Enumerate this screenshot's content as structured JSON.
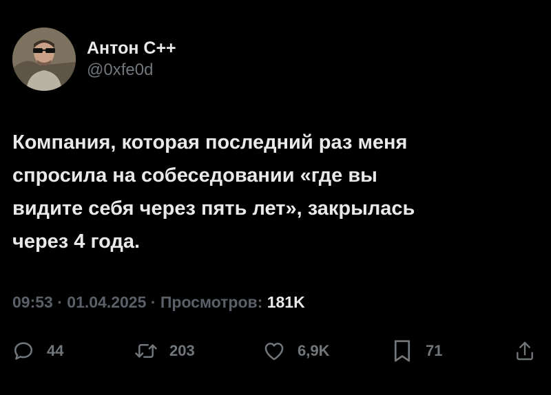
{
  "author": {
    "display_name": "Антон C++",
    "handle": "@0xfe0d",
    "avatar_icon": "user-avatar"
  },
  "tweet": {
    "text": "Компания, которая последний раз меня\nспросила на собеседовании «где вы\nвидите себя через пять лет», закрылась\nчерез 4 года."
  },
  "meta": {
    "time": "09:53",
    "separator": " · ",
    "date": "01.04.2025",
    "views_label": "Просмотров:",
    "views_count": "181K"
  },
  "actions": {
    "replies": {
      "icon": "reply-icon",
      "count": "44"
    },
    "retweets": {
      "icon": "retweet-icon",
      "count": "203"
    },
    "likes": {
      "icon": "heart-icon",
      "count": "6,9K"
    },
    "bookmarks": {
      "icon": "bookmark-icon",
      "count": "71"
    },
    "share": {
      "icon": "share-icon"
    }
  },
  "colors": {
    "background": "#000000",
    "primary_text": "#e7e9ea",
    "secondary_text": "#71767b"
  }
}
